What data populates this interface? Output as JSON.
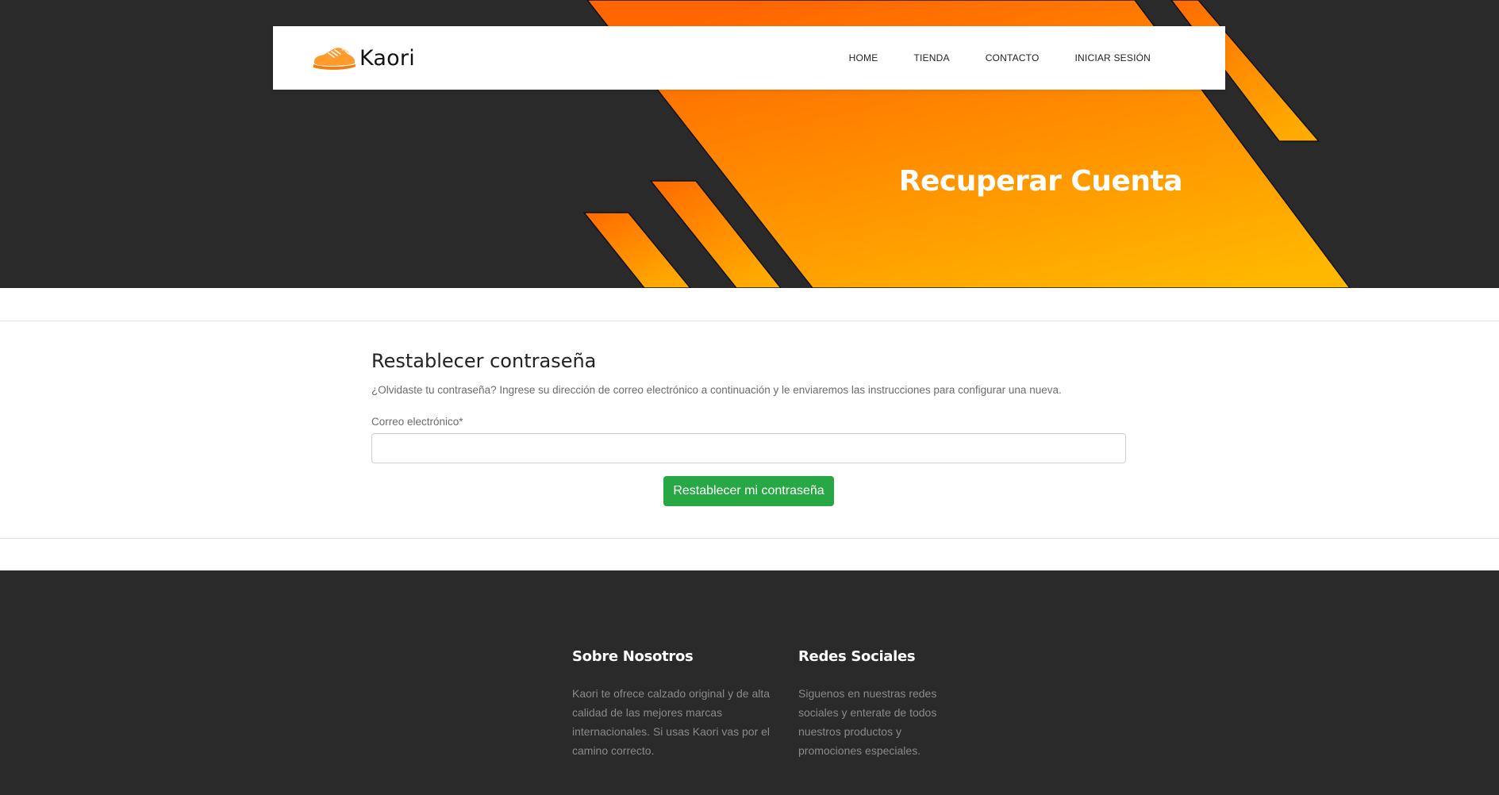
{
  "brand": {
    "name": "Kaori"
  },
  "nav": {
    "items": [
      {
        "label": "HOME"
      },
      {
        "label": "TIENDA"
      },
      {
        "label": "CONTACTO"
      },
      {
        "label": "INICIAR SESIÓN"
      }
    ]
  },
  "hero": {
    "title": "Recuperar Cuenta"
  },
  "form": {
    "title": "Restablecer contraseña",
    "description": "¿Olvidaste tu contraseña? Ingrese su dirección de correo electrónico a continuación y le enviaremos las instrucciones para configurar una nueva.",
    "email_label": "Correo electrónico*",
    "email_value": "",
    "submit_label": "Restablecer mi contraseña"
  },
  "footer": {
    "about": {
      "title": "Sobre Nosotros",
      "text": "Kaori te ofrece calzado original y de alta calidad de las mejores marcas internacionales. Si usas Kaori vas por el camino correcto."
    },
    "social": {
      "title": "Redes Sociales",
      "text": "Siguenos en nuestras redes sociales y enterate de todos nuestros productos y promociones especiales."
    }
  },
  "colors": {
    "dark_background": "#2a2a2a",
    "accent_orange": "#ff6a00",
    "accent_yellow": "#ffb800",
    "button_green": "#28a745"
  },
  "icons": {
    "logo": "sneaker-icon"
  }
}
